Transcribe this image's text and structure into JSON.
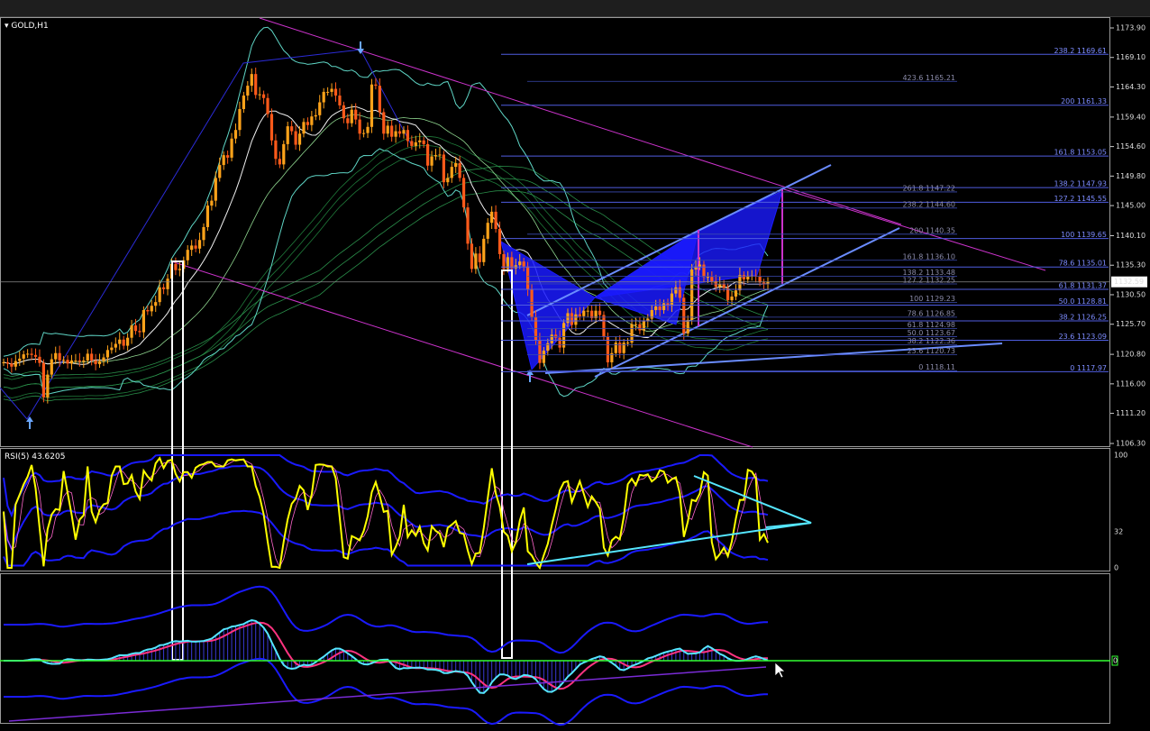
{
  "window": {
    "symbol_label": "GOLD,H1"
  },
  "colors": {
    "background": "#000000",
    "price_line": "#e0e0e0",
    "bull_candle": "#ffa31a",
    "bear_candle": "#ff5a1a",
    "fib_line": "#4f5de0",
    "channel": "#cc33cc",
    "pattern": "#1a1aff",
    "rsi": "#ffff00",
    "signal": "#55e6ff",
    "zero_line": "#33ff33"
  },
  "axes": {
    "price_ticks": [
      "1173.90",
      "1169.10",
      "1164.30",
      "1159.40",
      "1154.60",
      "1149.80",
      "1145.00",
      "1140.10",
      "1135.30",
      "1130.50",
      "1125.70",
      "1120.80",
      "1116.00",
      "1111.20",
      "1106.30"
    ],
    "current_price": "1132.59",
    "rsi_ticks": [
      "100",
      "32",
      "0"
    ],
    "zero_marker": "0"
  },
  "fib_right": [
    "238.2 1169.61",
    "200 1161.33",
    "161.8 1153.05",
    "138.2 1147.93",
    "127.2 1145.55",
    "100 1139.65",
    "78.6 1135.01",
    "61.8 1131.37",
    "50.0 1128.81",
    "38.2 1126.25",
    "23.6 1123.09",
    "0 1117.97"
  ],
  "fib_inner": [
    "423.6 1165.21",
    "261.8 1147.22",
    "238.2 1144.60",
    "200 1140.35",
    "161.8 1136.10",
    "138.2 1133.48",
    "127.2 1132.25",
    "100 1129.23",
    "78.6 1126.85",
    "61.8 1124.98",
    "50.0 1123.67",
    "38.2 1122.36",
    "23.6 1120.73",
    "0 1118.11"
  ],
  "rsi": {
    "label": "RSI(5) 43.6205"
  },
  "chart_data": {
    "type": "candlestick",
    "title": "",
    "symbol": "GOLD",
    "timeframe": "H1",
    "y_range": [
      1106.3,
      1175.5
    ],
    "grid": false,
    "close_approx": [
      1119.5,
      1119.3,
      1118.8,
      1119.7,
      1120.1,
      1120.8,
      1120.9,
      1120.7,
      1120.4,
      1119.4,
      1113.8,
      1117.5,
      1120.0,
      1121.0,
      1119.8,
      1119.9,
      1119.3,
      1119.8,
      1119.8,
      1119.6,
      1119.8,
      1120.9,
      1119.8,
      1119.2,
      1119.7,
      1120.3,
      1121.5,
      1121.9,
      1122.5,
      1123.2,
      1122.2,
      1123.5,
      1125.5,
      1124.6,
      1124.4,
      1128.0,
      1127.8,
      1128.7,
      1129.3,
      1131.7,
      1131.4,
      1133.1,
      1135.5,
      1134.5,
      1134.7,
      1136.1,
      1137.8,
      1138.5,
      1138.0,
      1139.4,
      1141.5,
      1145.0,
      1145.8,
      1149.5,
      1151.6,
      1153.2,
      1152.8,
      1155.9,
      1157.3,
      1160.7,
      1162.9,
      1164.5,
      1166.4,
      1163.0,
      1163.1,
      1162.5,
      1159.9,
      1155.6,
      1152.6,
      1151.7,
      1155.0,
      1157.9,
      1157.1,
      1154.9,
      1156.7,
      1158.6,
      1158.1,
      1159.5,
      1159.7,
      1161.8,
      1163.5,
      1163.5,
      1164.0,
      1162.9,
      1161.3,
      1159.2,
      1158.4,
      1160.6,
      1159.0,
      1156.7,
      1156.8,
      1157.8,
      1164.7,
      1164.5,
      1160.2,
      1156.7,
      1158.0,
      1156.2,
      1157.1,
      1156.7,
      1157.3,
      1155.5,
      1154.7,
      1155.3,
      1155.6,
      1155.0,
      1151.5,
      1153.0,
      1153.2,
      1153.3,
      1148.8,
      1149.5,
      1151.3,
      1151.9,
      1149.5,
      1144.7,
      1138.8,
      1134.7,
      1137.2,
      1135.8,
      1139.6,
      1142.2,
      1144.0,
      1141.2,
      1137.1,
      1134.7,
      1136.6,
      1134.8,
      1135.3,
      1135.9,
      1135.1,
      1131.3,
      1126.9,
      1123.1,
      1119.4,
      1121.4,
      1122.6,
      1124.0,
      1123.5,
      1121.9,
      1125.9,
      1127.5,
      1125.6,
      1127.3,
      1127.0,
      1127.9,
      1127.9,
      1126.7,
      1127.9,
      1127.2,
      1123.6,
      1119.5,
      1121.0,
      1122.7,
      1121.0,
      1122.7,
      1122.7,
      1125.7,
      1125.7,
      1124.7,
      1126.2,
      1126.6,
      1128.0,
      1128.6,
      1128.0,
      1129.1,
      1128.7,
      1130.7,
      1131.7,
      1130.0,
      1124.2,
      1126.4,
      1134.6,
      1135.1,
      1135.4,
      1133.4,
      1133.4,
      1132.7,
      1131.8,
      1132.3,
      1131.6,
      1129.6,
      1130.2,
      1131.2,
      1133.7,
      1133.0,
      1133.6,
      1133.6,
      1133.5,
      1132.5,
      1132.2,
      1132.6
    ]
  }
}
